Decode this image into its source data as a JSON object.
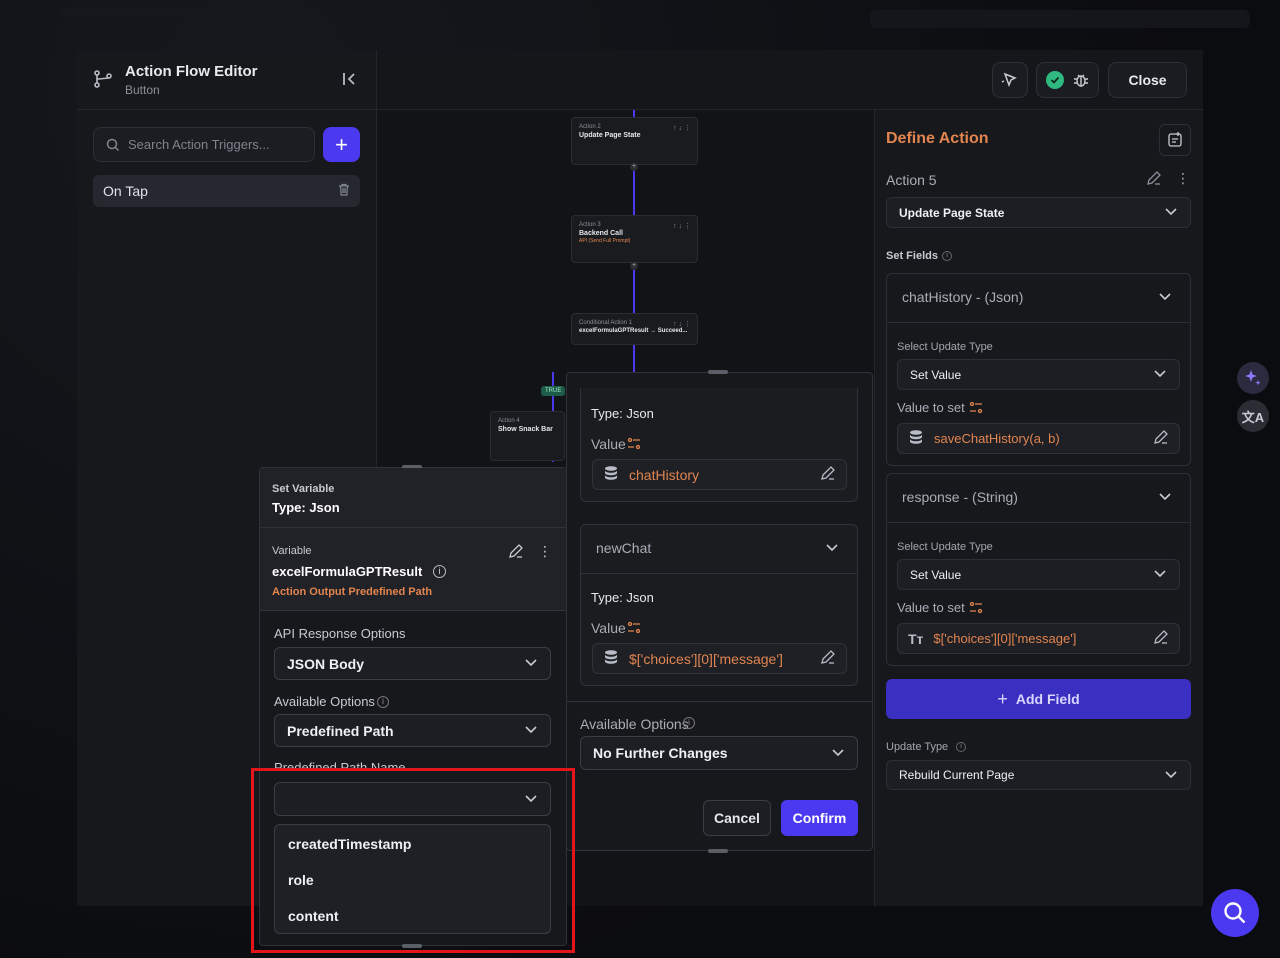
{
  "editor": {
    "title": "Action Flow Editor",
    "subtitle": "Button",
    "search_placeholder": "Search Action Triggers...",
    "trigger_label": "On Tap",
    "close_label": "Close"
  },
  "canvas": {
    "nodes": [
      {
        "label": "Action 2",
        "title": "Update Page State",
        "sub": ""
      },
      {
        "label": "Action 3",
        "title": "Backend Call",
        "sub": "API (Send Full Prompt)"
      },
      {
        "label": "Conditional Action 1",
        "title": "excelFormulaGPTResult → Succeed...",
        "sub": ""
      },
      {
        "label": "Action 4",
        "title": "Show Snack Bar",
        "sub": ""
      }
    ],
    "true_tag": "TRUE"
  },
  "middle": {
    "type_label_1": "Type: Json",
    "value_label_1": "Value",
    "value_1": "chatHistory",
    "newchat_title": "newChat",
    "type_label_2": "Type: Json",
    "value_label_2": "Value",
    "value_2": "$['choices'][0]['message']",
    "available_options_label": "Available Options",
    "available_options_value": "No Further Changes",
    "cancel": "Cancel",
    "confirm": "Confirm"
  },
  "popup": {
    "head_label": "Set Variable",
    "head_type": "Type: Json",
    "variable_label": "Variable",
    "variable_name": "excelFormulaGPTResult",
    "variable_sub": "Action Output Predefined Path",
    "api_label": "API Response Options",
    "api_value": "JSON Body",
    "avail_label": "Available Options",
    "avail_value": "Predefined Path",
    "path_label": "Predefined Path Name",
    "path_value": "",
    "options": [
      "createdTimestamp",
      "role",
      "content"
    ]
  },
  "right": {
    "define_title": "Define Action",
    "action_label": "Action 5",
    "action_value": "Update Page State",
    "set_fields": "Set Fields",
    "fields": [
      {
        "title": "chatHistory - (Json)",
        "update_type_label": "Select Update Type",
        "update_type": "Set Value",
        "value_label": "Value to set",
        "value": "saveChatHistory(a, b)"
      },
      {
        "title": "response - (String)",
        "update_type_label": "Select Update Type",
        "update_type": "Set Value",
        "value_label": "Value to set",
        "value": "$['choices'][0]['message']"
      }
    ],
    "add_field": "Add Field",
    "update_type_label": "Update Type",
    "update_type_value": "Rebuild Current Page"
  }
}
